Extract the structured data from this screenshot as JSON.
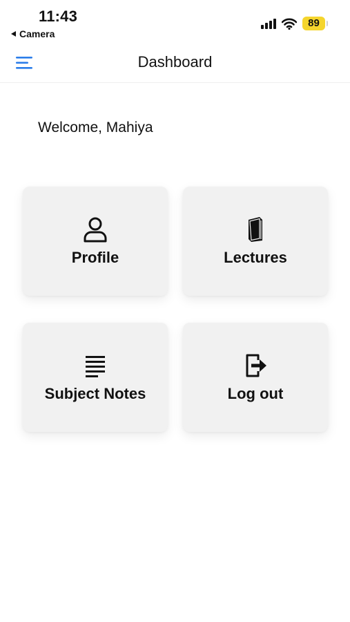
{
  "status_bar": {
    "time": "11:43",
    "back_app": "Camera",
    "battery": "89",
    "battery_color": "#f5d52d"
  },
  "header": {
    "title": "Dashboard",
    "menu_icon": "hamburger-menu-icon",
    "accent": "#2b7de9"
  },
  "welcome": {
    "text": "Welcome, Mahiya"
  },
  "tiles": [
    {
      "label": "Profile",
      "icon": "user-icon"
    },
    {
      "label": "Lectures",
      "icon": "book-icon"
    },
    {
      "label": "Subject Notes",
      "icon": "notes-icon"
    },
    {
      "label": "Log out",
      "icon": "logout-icon"
    }
  ]
}
